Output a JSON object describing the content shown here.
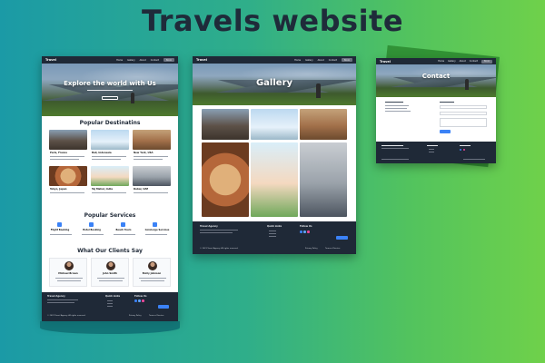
{
  "page": {
    "title": "Travels website"
  },
  "nav": {
    "logo": "Travel",
    "links": [
      "Home",
      "Gallery",
      "About",
      "Contact"
    ],
    "cta": "Book"
  },
  "home": {
    "hero_title": "Explore the world with Us",
    "section_destinations": "Popular Destinatins",
    "destinations": [
      "Paris, France",
      "Bali, Indonesia",
      "New York, USA",
      "Tokyo, Japan",
      "Taj Mahal, India",
      "Dubai, UAE"
    ],
    "section_services": "Popular Services",
    "services": [
      "Flight Booking",
      "Hotel Booking",
      "Beach Tours",
      "Concierge Services"
    ],
    "section_clients": "What Our Clients Say",
    "clients": [
      "Michael Brown",
      "John Smith",
      "Emily Johnson"
    ]
  },
  "gallery": {
    "hero_title": "Gallery"
  },
  "contact": {
    "hero_title": "Contact"
  },
  "footer": {
    "brand": "Travel Agency",
    "quick_links": "Quick Links",
    "follow": "Follow Us",
    "copyright": "© 2023 Travel Agency. All rights reserved.",
    "privacy": "Privacy Policy",
    "terms": "Terms of Service"
  },
  "colors": {
    "bg_left": "#1b9aa6",
    "bg_right": "#6fd14a",
    "nav": "#1f2937",
    "footer": "#1f2937",
    "accent": "#3b82f6"
  }
}
